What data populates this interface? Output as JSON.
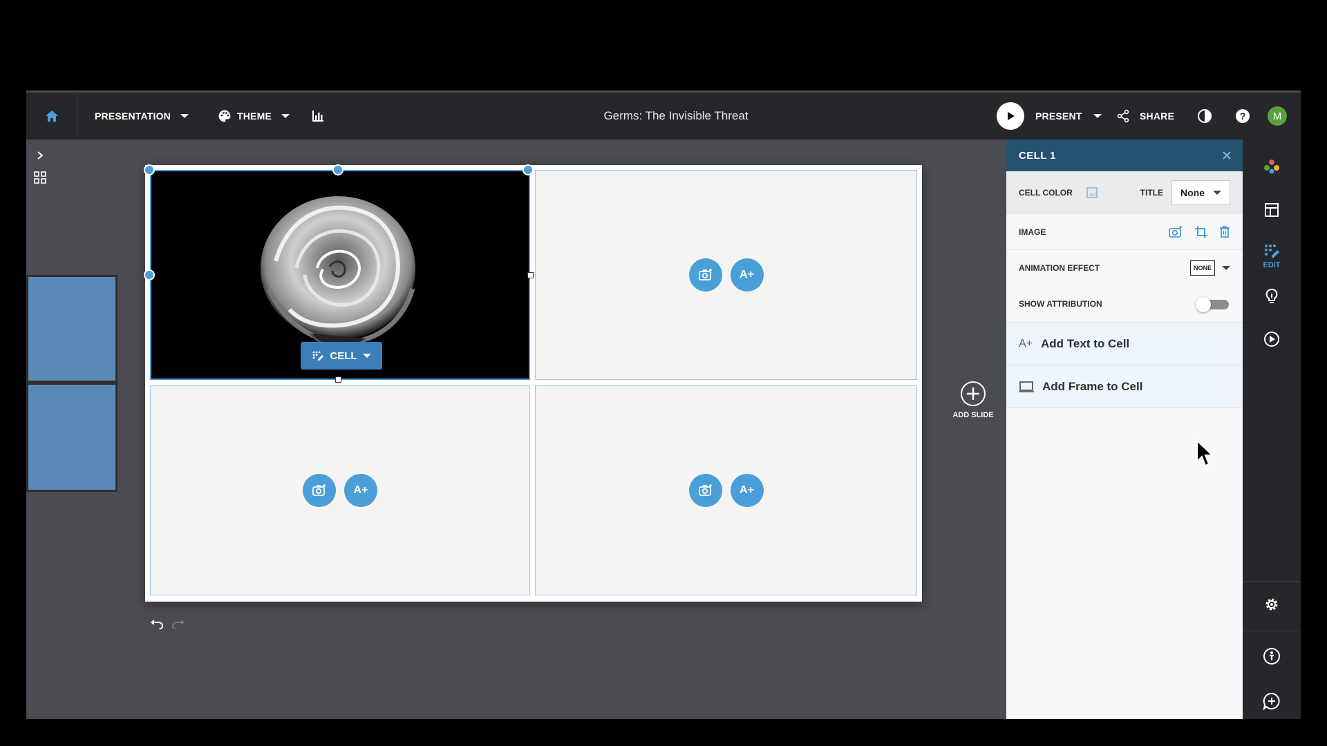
{
  "topbar": {
    "presentation_label": "PRESENTATION",
    "theme_label": "THEME",
    "document_title": "Germs: The Invisible Threat",
    "present_label": "PRESENT",
    "share_label": "SHARE",
    "avatar_initial": "M"
  },
  "slide": {
    "cell_menu_label": "CELL",
    "add_text_glyph": "A+"
  },
  "add_slide_label": "ADD SLIDE",
  "panel": {
    "title": "CELL 1",
    "cell_color_label": "CELL COLOR",
    "title_label": "TITLE",
    "title_value": "None",
    "image_label": "IMAGE",
    "animation_label": "ANIMATION EFFECT",
    "animation_value": "NONE",
    "attribution_label": "SHOW ATTRIBUTION",
    "attribution_on": false,
    "add_text_label": "Add Text to Cell",
    "add_frame_label": "Add Frame to Cell"
  },
  "right_toolbar": {
    "edit_label": "EDIT"
  },
  "colors": {
    "accent": "#4a9fd8",
    "panel_header": "#26516f",
    "topbar": "#26272b",
    "canvas": "#4a4c52"
  }
}
